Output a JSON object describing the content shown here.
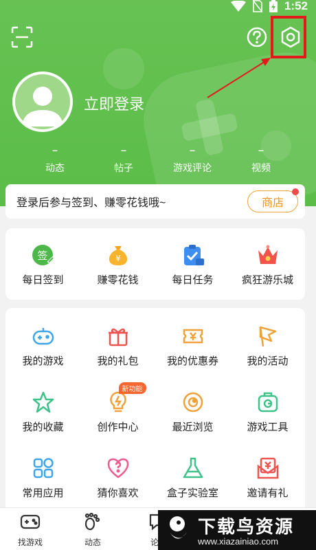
{
  "status_bar": {
    "time": "1:52"
  },
  "profile": {
    "login_text": "立即登录"
  },
  "stats": [
    {
      "value": "–",
      "label": "动态"
    },
    {
      "value": "–",
      "label": "帖子"
    },
    {
      "value": "–",
      "label": "游戏评论"
    },
    {
      "value": "–",
      "label": "视频"
    }
  ],
  "sign_banner": {
    "text": "登录后参与签到、赚零花钱哦~",
    "shop_label": "商店"
  },
  "quick_actions": [
    {
      "label": "每日签到",
      "icon": "sign-in-icon",
      "glyph": "签"
    },
    {
      "label": "赚零花钱",
      "icon": "money-bag-icon",
      "glyph": "¥"
    },
    {
      "label": "每日任务",
      "icon": "task-icon",
      "glyph": ""
    },
    {
      "label": "疯狂游乐城",
      "icon": "crown-icon",
      "glyph": ""
    }
  ],
  "menu": [
    {
      "label": "我的游戏",
      "icon": "gamepad-icon"
    },
    {
      "label": "我的礼包",
      "icon": "gift-icon"
    },
    {
      "label": "我的优惠券",
      "icon": "coupon-icon"
    },
    {
      "label": "我的活动",
      "icon": "flag-icon"
    },
    {
      "label": "我的收藏",
      "icon": "star-icon"
    },
    {
      "label": "创作中心",
      "icon": "bulb-icon",
      "badge": "新功能"
    },
    {
      "label": "最近浏览",
      "icon": "eye-icon"
    },
    {
      "label": "游戏工具",
      "icon": "toolbox-icon"
    },
    {
      "label": "常用应用",
      "icon": "apps-icon"
    },
    {
      "label": "猜你喜欢",
      "icon": "heart-question-icon"
    },
    {
      "label": "盒子实验室",
      "icon": "flask-icon"
    },
    {
      "label": "邀请有礼",
      "icon": "invite-icon"
    }
  ],
  "tabbar": [
    {
      "label": "找游戏",
      "icon": "gamepad-icon"
    },
    {
      "label": "动态",
      "icon": "footprint-icon"
    },
    {
      "label": "论坛",
      "icon": "chat-icon"
    }
  ],
  "watermark": {
    "title": "下载鸟资源",
    "url": "www.xiazainiao.com"
  },
  "colors": {
    "header_green": "#5bbd48",
    "accent_orange": "#f08f13",
    "annotation_red": "#e41a1a"
  }
}
